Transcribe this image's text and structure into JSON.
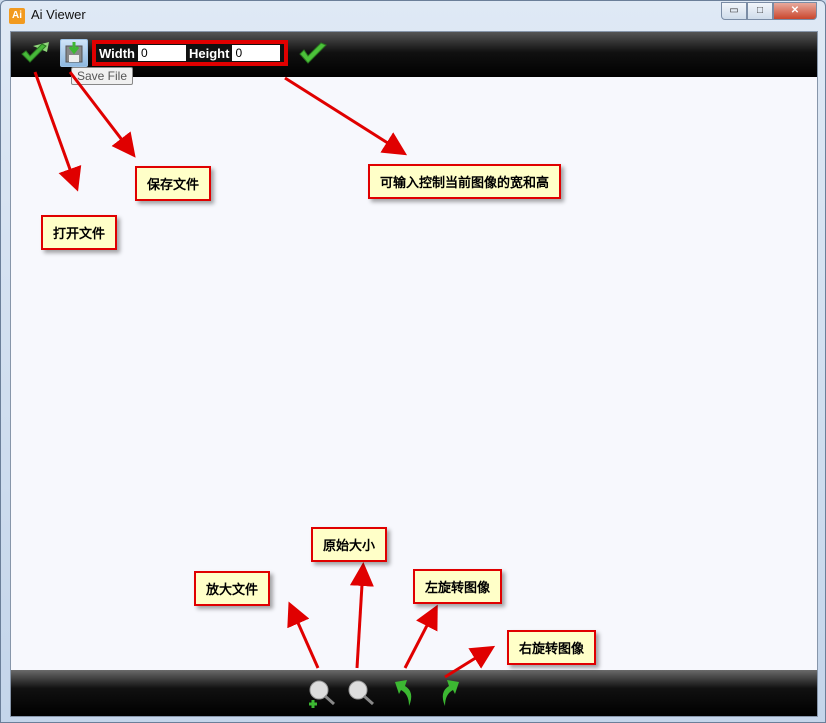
{
  "window": {
    "title": "Ai Viewer",
    "app_icon_text": "Ai",
    "minimize": "▭",
    "maximize": "□",
    "close": "✕"
  },
  "toolbar": {
    "open_icon": "folder-check-icon",
    "save_icon": "save-file-icon",
    "save_tooltip": "Save File",
    "width_label": "Width",
    "width_value": "0",
    "height_label": "Height",
    "height_value": "0",
    "apply_icon": "check-icon"
  },
  "bottombar": {
    "icons": [
      "zoom-in-icon",
      "zoom-original-icon",
      "rotate-left-icon",
      "rotate-right-icon"
    ]
  },
  "annotations": {
    "open_file": "打开文件",
    "save_file": "保存文件",
    "size_input": "可输入控制当前图像的宽和高",
    "zoom_in": "放大文件",
    "original_size": "原始大小",
    "rotate_left": "左旋转图像",
    "rotate_right": "右旋转图像"
  },
  "colors": {
    "annotation_border": "#e00000",
    "annotation_bg": "#ffffc8",
    "accent_green": "#3cb832"
  }
}
